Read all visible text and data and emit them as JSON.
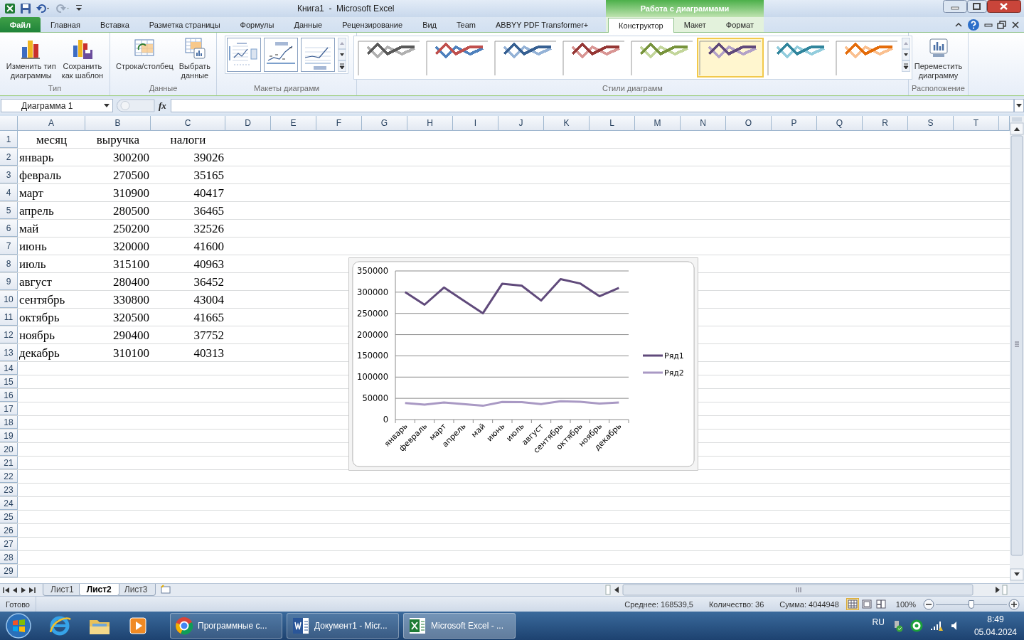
{
  "window": {
    "title": "Книга1  -  Microsoft Excel",
    "context_group": "Работа с диаграммами"
  },
  "ribbon_tabs": [
    {
      "label": "Файл",
      "kind": "file",
      "selected": false
    },
    {
      "label": "Главная",
      "kind": "plain",
      "selected": false
    },
    {
      "label": "Вставка",
      "kind": "plain",
      "selected": false
    },
    {
      "label": "Разметка страницы",
      "kind": "plain",
      "selected": false
    },
    {
      "label": "Формулы",
      "kind": "plain",
      "selected": false
    },
    {
      "label": "Данные",
      "kind": "plain",
      "selected": false
    },
    {
      "label": "Рецензирование",
      "kind": "plain",
      "selected": false
    },
    {
      "label": "Вид",
      "kind": "plain",
      "selected": false
    },
    {
      "label": "Team",
      "kind": "plain",
      "selected": false
    },
    {
      "label": "ABBYY PDF Transformer+",
      "kind": "plain",
      "selected": false
    },
    {
      "label": "Конструктор",
      "kind": "context",
      "selected": true
    },
    {
      "label": "Макет",
      "kind": "context",
      "selected": false
    },
    {
      "label": "Формат",
      "kind": "context",
      "selected": false
    }
  ],
  "ribbon_groups": [
    {
      "label": "Тип",
      "kind": "buttons",
      "buttons": [
        "Изменить тип\nдиаграммы",
        "Сохранить\nкак шаблон"
      ]
    },
    {
      "label": "Данные",
      "kind": "buttons",
      "buttons": [
        "Строка/столбец",
        "Выбрать\nданные"
      ]
    },
    {
      "label": "Макеты диаграмм",
      "kind": "layouts",
      "layouts": [
        {
          "selected": false
        },
        {
          "selected": false
        },
        {
          "selected": false
        }
      ]
    },
    {
      "label": "Стили диаграмм",
      "kind": "styles",
      "styles": [
        {
          "lines": [
            {
              "color": "#595959"
            },
            {
              "color": "#b0b0b0"
            }
          ],
          "selected": false
        },
        {
          "lines": [
            {
              "color": "#c0504d"
            },
            {
              "color": "#4f81bd"
            }
          ],
          "selected": false
        },
        {
          "lines": [
            {
              "color": "#376092"
            },
            {
              "color": "#95b3d7"
            }
          ],
          "selected": false
        },
        {
          "lines": [
            {
              "color": "#953735"
            },
            {
              "color": "#d99694"
            }
          ],
          "selected": false
        },
        {
          "lines": [
            {
              "color": "#77933c"
            },
            {
              "color": "#c3d69b"
            }
          ],
          "selected": false
        },
        {
          "lines": [
            {
              "color": "#604a7b"
            },
            {
              "color": "#b3a2c7"
            }
          ],
          "selected": true
        },
        {
          "lines": [
            {
              "color": "#31859c"
            },
            {
              "color": "#93cddd"
            }
          ],
          "selected": false
        },
        {
          "lines": [
            {
              "color": "#e46c0a"
            },
            {
              "color": "#fac090"
            }
          ],
          "selected": false
        }
      ]
    },
    {
      "label": "Расположение",
      "kind": "buttons",
      "buttons": [
        "Переместить\nдиаграмму"
      ]
    }
  ],
  "formula_bar": {
    "name_box": "Диаграмма 1",
    "function_label": "fx"
  },
  "sheet": {
    "columns": [
      "A",
      "B",
      "C",
      "D",
      "E",
      "F",
      "G",
      "H",
      "I",
      "J",
      "K",
      "L",
      "M",
      "N",
      "O",
      "P",
      "Q",
      "R",
      "S",
      "T"
    ],
    "rows": [
      {
        "number": "1",
        "cells": [
          "месяц",
          "выручка",
          "налоги"
        ]
      },
      {
        "number": "2",
        "cells": [
          "январь",
          "300200",
          "39026"
        ]
      },
      {
        "number": "3",
        "cells": [
          "февраль",
          "270500",
          "35165"
        ]
      },
      {
        "number": "4",
        "cells": [
          "март",
          "310900",
          "40417"
        ]
      },
      {
        "number": "5",
        "cells": [
          "апрель",
          "280500",
          "36465"
        ]
      },
      {
        "number": "6",
        "cells": [
          "май",
          "250200",
          "32526"
        ]
      },
      {
        "number": "7",
        "cells": [
          "июнь",
          "320000",
          "41600"
        ]
      },
      {
        "number": "8",
        "cells": [
          "июль",
          "315100",
          "40963"
        ]
      },
      {
        "number": "9",
        "cells": [
          "август",
          "280400",
          "36452"
        ]
      },
      {
        "number": "10",
        "cells": [
          "сентябрь",
          "330800",
          "43004"
        ]
      },
      {
        "number": "11",
        "cells": [
          "октябрь",
          "320500",
          "41665"
        ]
      },
      {
        "number": "12",
        "cells": [
          "ноябрь",
          "290400",
          "37752"
        ]
      },
      {
        "number": "13",
        "cells": [
          "декабрь",
          "310100",
          "40313"
        ]
      },
      {
        "number": "14"
      },
      {
        "number": "15"
      },
      {
        "number": "16"
      },
      {
        "number": "17"
      },
      {
        "number": "18"
      },
      {
        "number": "19"
      },
      {
        "number": "20"
      },
      {
        "number": "21"
      },
      {
        "number": "22"
      },
      {
        "number": "23"
      },
      {
        "number": "24"
      },
      {
        "number": "25"
      },
      {
        "number": "26"
      },
      {
        "number": "27"
      },
      {
        "number": "28"
      },
      {
        "number": "29"
      }
    ]
  },
  "chart": {
    "chart_data": {
      "type": "line",
      "categories": [
        "январь",
        "февраль",
        "март",
        "апрель",
        "май",
        "июнь",
        "июль",
        "август",
        "сентябрь",
        "октябрь",
        "ноябрь",
        "декабрь"
      ],
      "series": [
        {
          "name": "Ряд1",
          "color": "#604a7b",
          "values": [
            300200,
            270500,
            310900,
            280500,
            250200,
            320000,
            315100,
            280400,
            330800,
            320500,
            290400,
            310100
          ]
        },
        {
          "name": "Ряд2",
          "color": "#a999c4",
          "values": [
            39026,
            35165,
            40417,
            36465,
            32526,
            41600,
            40963,
            36452,
            43004,
            41665,
            37752,
            40313
          ]
        }
      ],
      "grid": true,
      "legend": "right",
      "ylim": [
        0,
        350000
      ],
      "yticks": [
        0,
        50000,
        100000,
        150000,
        200000,
        250000,
        300000,
        350000
      ]
    }
  },
  "sheet_tabs": [
    {
      "label": "Лист1",
      "selected": false
    },
    {
      "label": "Лист2",
      "selected": true
    },
    {
      "label": "Лист3",
      "selected": false
    }
  ],
  "status_bar": {
    "ready": "Готово",
    "average": "Среднее: 168539,5",
    "count": "Количество: 36",
    "sum": "Сумма: 4044948",
    "views": [
      {
        "selected": true
      },
      {
        "selected": false
      },
      {
        "selected": false
      }
    ],
    "zoom": "100%",
    "zoom_slider": {
      "level": 0.5
    }
  },
  "taskbar": {
    "windows": [
      {
        "label": "Программные с...",
        "selected": false
      },
      {
        "label": "Документ1 - Micr...",
        "selected": false
      },
      {
        "label": "Microsoft Excel - ...",
        "selected": true
      }
    ],
    "language": "RU",
    "time": "8:49",
    "date": "05.04.2024"
  }
}
